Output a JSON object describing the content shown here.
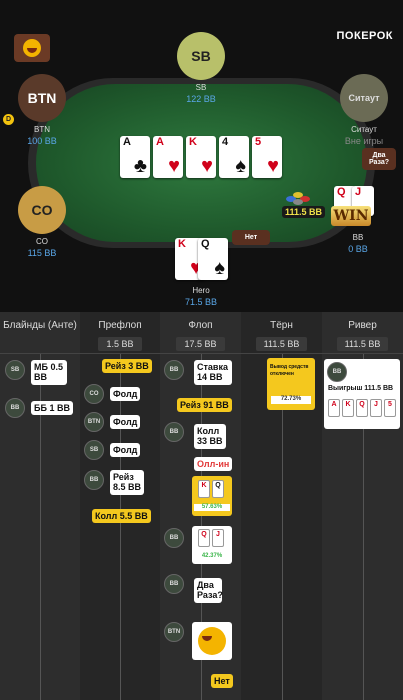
{
  "brand": "ПОКЕРОК",
  "seats": {
    "sb": {
      "avatar": "SB",
      "name": "SB",
      "stack": "122 BB"
    },
    "btn": {
      "avatar": "BTN",
      "name": "BTN",
      "stack": "100 BB"
    },
    "sitout": {
      "avatar": "Ситаут",
      "name": "Ситаут",
      "stack": "Вне игры"
    },
    "co": {
      "avatar": "CO",
      "name": "CO",
      "stack": "115 BB"
    },
    "bb": {
      "name": "BB",
      "stack": "0 BB"
    },
    "hero": {
      "name": "Hero",
      "stack": "71.5 BB"
    }
  },
  "dealer_button": "D",
  "board": [
    {
      "rank": "A",
      "suit": "♣"
    },
    {
      "rank": "A",
      "suit": "♥"
    },
    {
      "rank": "K",
      "suit": "♥"
    },
    {
      "rank": "4",
      "suit": "♠"
    },
    {
      "rank": "5",
      "suit": "♥"
    }
  ],
  "hero_cards": [
    {
      "rank": "K",
      "suit": "♥"
    },
    {
      "rank": "Q",
      "suit": "♠"
    }
  ],
  "bb_cards": [
    {
      "rank": "Q",
      "suit": "♥"
    },
    {
      "rank": "J",
      "suit": "♥"
    }
  ],
  "bubbles": {
    "bb": "Два Раза?",
    "hero": "Нет"
  },
  "pot_label": "111.5 BB",
  "win_label": "WIN",
  "columns": [
    {
      "title": "Блайнды (Анте)",
      "pot": ""
    },
    {
      "title": "Префлоп",
      "pot": "1.5 BB"
    },
    {
      "title": "Флоп",
      "pot": "17.5 BB"
    },
    {
      "title": "Тёрн",
      "pot": "111.5 BB"
    },
    {
      "title": "Ривер",
      "pot": "111.5 BB"
    }
  ],
  "blinds": [
    {
      "pos": "SB",
      "text": "МБ 0.5 BB"
    },
    {
      "pos": "BB",
      "text": "ББ 1 BB"
    }
  ],
  "preflop": [
    {
      "pos": "",
      "text": "Рейз 3 BB"
    },
    {
      "pos": "CO",
      "text": "Фолд"
    },
    {
      "pos": "BTN",
      "text": "Фолд"
    },
    {
      "pos": "SB",
      "text": "Фолд"
    },
    {
      "pos": "BB",
      "text": "Рейз 8.5 BB"
    },
    {
      "pos": "",
      "text": "Колл 5.5 BB"
    }
  ],
  "flop": {
    "bet": "Ставка 14 BB",
    "raise": "Рейз 91 BB",
    "call": "Колл 33 BB",
    "allin": "Олл-ин",
    "hero_equity": "57.63%",
    "bb_equity": "42.37%",
    "chat": "Два Раза?",
    "reply": "Нет",
    "positions": [
      "BB",
      "BB",
      "BB",
      "BB",
      "BTN"
    ]
  },
  "turn": {
    "note": "Вывод средств отключен",
    "equity": "72.73%"
  },
  "river": {
    "pos": "BB",
    "text": "Выигрыш 111.5 BB",
    "cards": [
      "A",
      "K",
      "Q",
      "J",
      "5"
    ]
  }
}
